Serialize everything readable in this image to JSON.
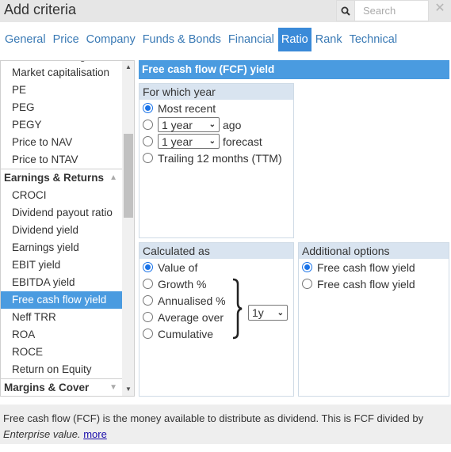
{
  "header": {
    "title": "Add criteria",
    "search_placeholder": "Search",
    "search_icon": "search-icon",
    "close_icon": "close-icon",
    "close_glyph": "✕"
  },
  "tabs": [
    {
      "label": "General",
      "active": false
    },
    {
      "label": "Price",
      "active": false
    },
    {
      "label": "Company",
      "active": false
    },
    {
      "label": "Funds & Bonds",
      "active": false
    },
    {
      "label": "Financial",
      "active": false
    },
    {
      "label": "Ratio",
      "active": true
    },
    {
      "label": "Rank",
      "active": false
    },
    {
      "label": "Technical",
      "active": false
    }
  ],
  "criteria_list": {
    "clipped_top_item": "Greenblatt magic form...",
    "valuation_items": [
      "Market capitalisation",
      "PE",
      "PEG",
      "PEGY",
      "Price to NAV",
      "Price to NTAV"
    ],
    "group_earnings": "Earnings & Returns",
    "earnings_items": [
      "CROCI",
      "Dividend payout ratio",
      "Dividend yield",
      "Earnings yield",
      "EBIT yield",
      "EBITDA yield",
      "Free cash flow yield",
      "Neff TRR",
      "ROA",
      "ROCE",
      "Return on Equity"
    ],
    "selected_item": "Free cash flow yield",
    "group_margins": "Margins & Cover",
    "caret_up": "▲",
    "caret_down": "▼"
  },
  "detail": {
    "title": "Free cash flow (FCF) yield",
    "for_which_year": {
      "heading": "For which year",
      "options": {
        "most_recent": "Most recent",
        "years_ago_select": "1 year",
        "years_ago_suffix": "ago",
        "forecast_select": "1 year",
        "forecast_suffix": "forecast",
        "ttm": "Trailing 12 months (TTM)"
      },
      "selected": "Most recent"
    },
    "calculated_as": {
      "heading": "Calculated as",
      "options": [
        "Value of",
        "Growth %",
        "Annualised %",
        "Average over",
        "Cumulative"
      ],
      "selected": "Value of",
      "period_select": "1y"
    },
    "additional_options": {
      "heading": "Additional options",
      "options": [
        "Free cash flow yield",
        "Free cash flow yield"
      ],
      "selected_index": 0
    }
  },
  "footer": {
    "text_plain": "Free cash flow (FCF) is the money available to distribute as dividend. This is FCF divided by",
    "text_italic": "Enterprise value.",
    "link": "more"
  }
}
